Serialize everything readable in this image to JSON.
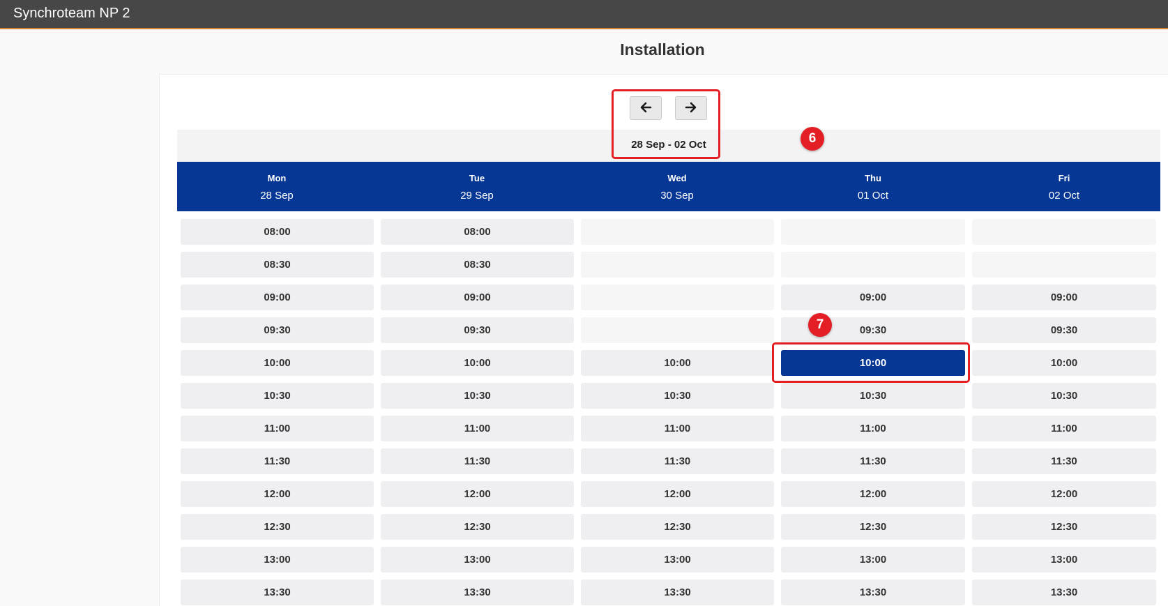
{
  "app": {
    "title": "Synchroteam NP 2"
  },
  "page": {
    "title": "Installation"
  },
  "week": {
    "label": "28 Sep - 02 Oct"
  },
  "days": [
    {
      "name": "Mon",
      "date": "28 Sep"
    },
    {
      "name": "Tue",
      "date": "29 Sep"
    },
    {
      "name": "Wed",
      "date": "30 Sep"
    },
    {
      "name": "Thu",
      "date": "01 Oct"
    },
    {
      "name": "Fri",
      "date": "02 Oct"
    }
  ],
  "slots": [
    [
      "08:00",
      "08:00",
      "",
      "",
      ""
    ],
    [
      "08:30",
      "08:30",
      "",
      "",
      ""
    ],
    [
      "09:00",
      "09:00",
      "",
      "09:00",
      "09:00"
    ],
    [
      "09:30",
      "09:30",
      "",
      "09:30",
      "09:30"
    ],
    [
      "10:00",
      "10:00",
      "10:00",
      "10:00",
      "10:00"
    ],
    [
      "10:30",
      "10:30",
      "10:30",
      "10:30",
      "10:30"
    ],
    [
      "11:00",
      "11:00",
      "11:00",
      "11:00",
      "11:00"
    ],
    [
      "11:30",
      "11:30",
      "11:30",
      "11:30",
      "11:30"
    ],
    [
      "12:00",
      "12:00",
      "12:00",
      "12:00",
      "12:00"
    ],
    [
      "12:30",
      "12:30",
      "12:30",
      "12:30",
      "12:30"
    ],
    [
      "13:00",
      "13:00",
      "13:00",
      "13:00",
      "13:00"
    ],
    [
      "13:30",
      "13:30",
      "13:30",
      "13:30",
      "13:30"
    ]
  ],
  "selected": {
    "row": 4,
    "col": 3
  },
  "annotations": [
    {
      "label": "6"
    },
    {
      "label": "7"
    }
  ],
  "icons": {
    "prev": "arrow-left-icon",
    "next": "arrow-right-icon"
  },
  "colors": {
    "header_blue": "#073795",
    "highlight_red": "#e31e24",
    "topbar": "#474747"
  }
}
